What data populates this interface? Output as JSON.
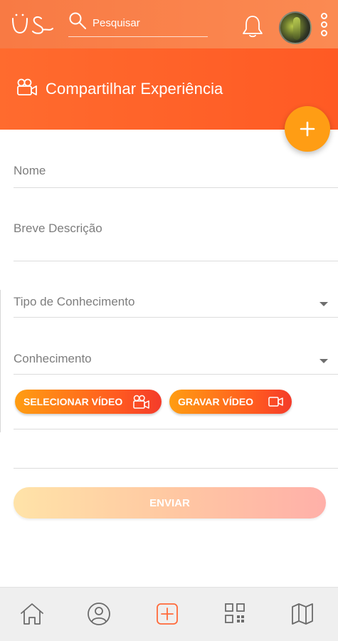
{
  "topbar": {
    "search_placeholder": "Pesquisar"
  },
  "header": {
    "title": "Compartilhar Experiência"
  },
  "form": {
    "name_label": "Nome",
    "description_label": "Breve Descrição",
    "knowledge_type_label": "Tipo de Conhecimento",
    "knowledge_label": "Conhecimento",
    "select_video_label": "SELECIONAR VÍDEO",
    "record_video_label": "GRAVAR VÍDEO",
    "send_label": "ENVIAR"
  },
  "colors": {
    "topbar": "#f87a44",
    "header": "#ff5a24",
    "fab": "#ff9d14",
    "active_nav": "#ff6a3a"
  },
  "icons": {
    "logo": "us-logo",
    "search": "search-icon",
    "notification": "bell-icon",
    "menu": "kebab-menu-icon",
    "header": "video-camera-icon",
    "fab": "plus-icon",
    "nav": [
      "home-icon",
      "profile-icon",
      "add-icon",
      "qr-code-icon",
      "map-icon"
    ]
  }
}
